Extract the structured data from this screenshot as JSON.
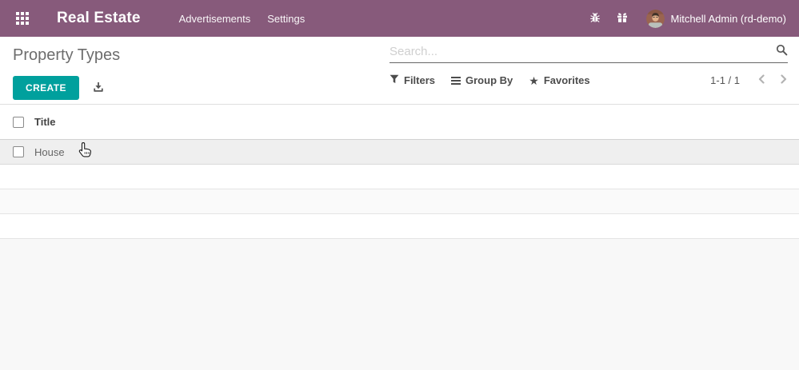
{
  "topbar": {
    "app_title": "Real Estate",
    "menu": [
      {
        "label": "Advertisements"
      },
      {
        "label": "Settings"
      }
    ],
    "user_name": "Mitchell Admin (rd-demo)"
  },
  "control_panel": {
    "page_title": "Property Types",
    "create_button": "CREATE",
    "search_placeholder": "Search...",
    "search_value": "",
    "filters_label": "Filters",
    "group_by_label": "Group By",
    "favorites_label": "Favorites",
    "pager_text": "1-1 / 1"
  },
  "table": {
    "columns": [
      {
        "label": "Title"
      }
    ],
    "rows": [
      {
        "title": "House"
      }
    ]
  },
  "icons": {
    "apps_grid": "grid-3x3",
    "bug": "bug",
    "gift": "gift-box",
    "search": "magnifier",
    "download": "download-tray",
    "filter": "funnel",
    "group_by": "hamburger-bars",
    "favorites_glyph": "★",
    "pager_prev": "chevron-left",
    "pager_next": "chevron-right",
    "hand_cursor": "hand-pointer"
  },
  "colors": {
    "topbar_bg": "#875A7B",
    "primary_button": "#00A09D",
    "page_title_text": "#6D6D6D",
    "hover_row_bg": "#EFEFEF",
    "zebra_row_bg": "#FAFAFA",
    "empty_area_bg": "#F8F8F8",
    "search_underline": "#666666"
  }
}
